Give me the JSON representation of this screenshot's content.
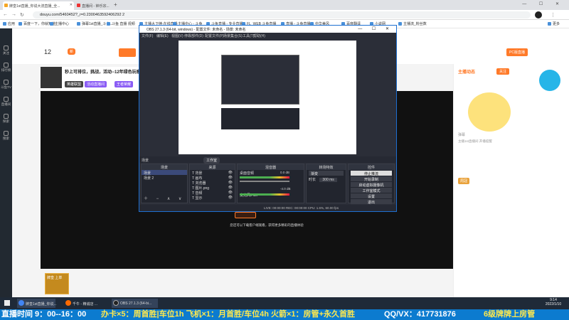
{
  "browser": {
    "tabs": [
      {
        "label": "牌皇1st直播_你说大流直播_全..."
      },
      {
        "label": "直播间 - 钟乐宗..."
      }
    ],
    "url": "douyu.com/5460452?_r=0.2300463592406292 2",
    "bookmarks": [
      "应用",
      "百度一下，你就知道",
      "主播中心",
      "弹幕1st直播_斗鱼...",
      "斗鱼 直播 视频",
      "主播大卫神·在线直播",
      "主播中心 - 斗鱼",
      "斗鱼直播 - 专业直播...",
      "FL_WEB 斗鱼直播",
      "直播 - 斗鱼直播",
      "中华美风",
      "百度翻译",
      "小说网",
      "主播流_粉丝数",
      "更多"
    ]
  },
  "site": {
    "left_nav": [
      "关注",
      "排行榜",
      "斗鱼TV",
      "直播间",
      "探索",
      "搜索"
    ],
    "room": {
      "title": "秒上可排位，挑战，活动--12年绿色玩家",
      "tags": [
        "英雄联盟",
        "活动直播间",
        "王者荣耀"
      ]
    },
    "header": {
      "count": "12",
      "badge": "新",
      "right_btn": "PC版直播"
    },
    "tags_row": [
      "1.9",
      "2.9",
      "4.9"
    ],
    "right": {
      "title": "主播动态",
      "follow": "关注",
      "chat": "弹幕",
      "sub_tip": "主播1st直播间 开播提醒",
      "level_chip": "周冠"
    },
    "below_notice": "您还可以下载客户端观看，获得更多精彩的直播体验",
    "bottom_card": "牌皇 上单"
  },
  "obs": {
    "title": "OBS 27.1.3 (64-bit, windows) - 配置文件: 未命名 - 场景: 未命名",
    "menu": [
      "文件(F)",
      "编辑(E)",
      "视图(V)",
      "停靠部件(D)",
      "配置文件(P)",
      "场景集合(S)",
      "工具(T)",
      "帮助(H)"
    ],
    "scene_switch": [
      "场景",
      "工作室"
    ],
    "docks": {
      "scenes": {
        "header": "场景",
        "items": [
          "场景",
          "场景 2"
        ]
      },
      "sources": {
        "header": "来源",
        "items": [
          "背景",
          "画布",
          "浏览器",
          "图片.png",
          "音频",
          "显示"
        ]
      },
      "mixer": {
        "header": "混音器",
        "tracks": [
          {
            "name": "桌面音频",
            "db": "0.0 dB"
          },
          {
            "name": "麦克风/Aux",
            "db": "-4.0 dB"
          }
        ]
      },
      "transitions": {
        "header": "转场特效",
        "type": "渐变",
        "duration_label": "时长",
        "duration": "300 ms"
      },
      "controls": {
        "header": "控件",
        "buttons": [
          "停止推流",
          "开始录制",
          "启动虚拟摄像机",
          "工作室模式",
          "设置",
          "退出"
        ]
      }
    },
    "status": "LIVE: 00:00:00   REC: 00:00:00   CPU: 1.6%, 60.00 fps"
  },
  "taskbar": {
    "items": [
      "牌皇1st直播_你说...",
      "千牛 - 精诚店 ...",
      "OBS 27.1.3 (64-bi..."
    ],
    "time": "9:14",
    "date": "2022/1/10"
  },
  "ticker": {
    "start": "直播时间 9：00--16：00",
    "middle": "办卡×5：周首胜|车位1h 飞机×1：月首胜/车位4h 火箭×1：房管+永久首胜",
    "contact": "QQ/VX：417731876",
    "end": "6级牌牌上房管"
  },
  "colors": {
    "ticker_bg": "#0c7bcf",
    "accent": "#ff7a29",
    "obs_bg": "#2b2e38"
  }
}
